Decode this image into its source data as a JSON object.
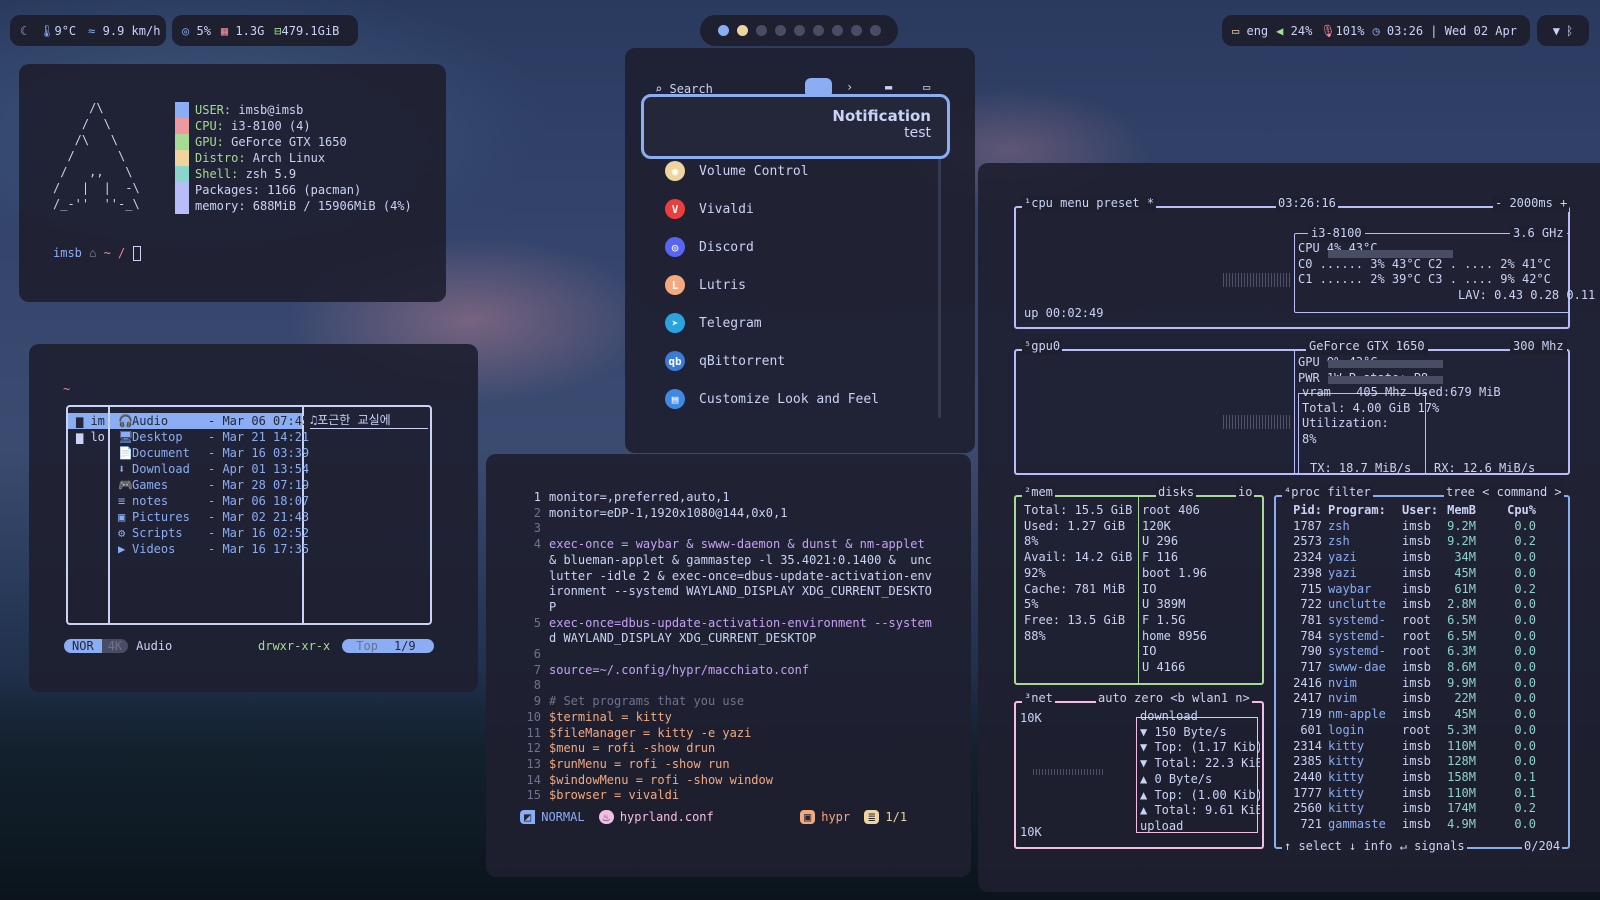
{
  "topbar": {
    "weather": {
      "temp": "9°C",
      "wind": "9.9 km/h"
    },
    "sys": {
      "cpu": "5%",
      "mem": "1.3G",
      "disk": "479.1GiB"
    },
    "right": {
      "lang": "eng",
      "volume": "24%",
      "mic": "101%",
      "clock": "03:26 | Wed 02 Apr"
    },
    "workspaces": 9,
    "active_workspace": 2
  },
  "fastfetch": {
    "logo": "     /\\\n    /  \\\n   /\\   \\\n  /      \\\n /   ,,   \\\n/   |  |  -\\\n/_-''  ''-_\\",
    "lines": [
      {
        "key": "USER:",
        "val": " imsb@imsb",
        "color": "#8aadf4"
      },
      {
        "key": "CPU:",
        "val": " i3-8100 (4)",
        "color": "#ee99a0"
      },
      {
        "key": "GPU:",
        "val": " GeForce GTX 1650",
        "color": "#a6da95"
      },
      {
        "key": "Distro:",
        "val": " Arch Linux",
        "color": "#eed49f"
      },
      {
        "key": "Shell:",
        "val": " zsh 5.9",
        "color": "#8bd5ca"
      },
      {
        "key": "",
        "val": "Packages: 1166 (pacman)",
        "color": "#b7bdf8"
      },
      {
        "key": "",
        "val": "memory: 688MiB / 15906MiB (4%)",
        "color": "#b7bdf8"
      }
    ],
    "prompt_user": "imsb",
    "prompt_path": "~ /"
  },
  "yazi": {
    "tilde": "~",
    "parent": [
      "im",
      "lo"
    ],
    "files": [
      {
        "name": "Audio",
        "date": "- Mar 06 07:45",
        "icon": "🎧"
      },
      {
        "name": "Desktop",
        "date": "- Mar 21 14:21",
        "icon": "🖥"
      },
      {
        "name": "Document",
        "date": "- Mar 16 03:39",
        "icon": "📄"
      },
      {
        "name": "Download",
        "date": "- Apr 01 13:54",
        "icon": "⬇"
      },
      {
        "name": "Games",
        "date": "- Mar 28 07:19",
        "icon": "🎮"
      },
      {
        "name": "notes",
        "date": "- Mar 06 18:07",
        "icon": "≡"
      },
      {
        "name": "Pictures",
        "date": "- Mar 02 21:43",
        "icon": "▣"
      },
      {
        "name": "Scripts",
        "date": "- Mar 16 02:52",
        "icon": "⚙"
      },
      {
        "name": "Videos",
        "date": "- Mar 16 17:35",
        "icon": "▶"
      }
    ],
    "preview": "♫포근한 교실에",
    "mode": "NOR",
    "size": "4K",
    "current": "Audio",
    "perms": "drwxr-xr-x",
    "pos_label": "Top",
    "count": "1/9"
  },
  "launcher": {
    "search_placeholder": "Search",
    "notification": {
      "title": "Notification",
      "body": "test"
    },
    "apps": [
      {
        "name": "Volume Control",
        "color": "#eed49f",
        "icon": "◉"
      },
      {
        "name": "Vivaldi",
        "color": "#ed3e3e",
        "icon": "V"
      },
      {
        "name": "Discord",
        "color": "#5865f2",
        "icon": "◎"
      },
      {
        "name": "Lutris",
        "color": "#f5a97f",
        "icon": "L"
      },
      {
        "name": "Telegram",
        "color": "#2aa3e0",
        "icon": "➤"
      },
      {
        "name": "qBittorrent",
        "color": "#3a7bd5",
        "icon": "qb"
      },
      {
        "name": "Customize Look and Feel",
        "color": "#3f8ae0",
        "icon": "▤"
      }
    ]
  },
  "editor": {
    "lines": [
      {
        "n": "1",
        "t": "monitor=,preferred,auto,1",
        "c": "#cad3f5"
      },
      {
        "n": "2",
        "t": "monitor=eDP-1,1920x1080@144,0x0,1",
        "c": "#cad3f5"
      },
      {
        "n": "3",
        "t": "",
        "c": "#cad3f5"
      },
      {
        "n": "4",
        "t": "exec-once = waybar & swww-daemon & dunst & nm-applet",
        "c": "#c6a0f6"
      },
      {
        "n": "",
        "t": "& blueman-applet & gammastep -l 35.4021:0.1400 &  unc",
        "c": "#cad3f5"
      },
      {
        "n": "",
        "t": "lutter -idle 2 & exec-once=dbus-update-activation-env",
        "c": "#cad3f5"
      },
      {
        "n": "",
        "t": "ironment --systemd WAYLAND_DISPLAY XDG_CURRENT_DESKTO",
        "c": "#cad3f5"
      },
      {
        "n": "",
        "t": "P",
        "c": "#cad3f5"
      },
      {
        "n": "5",
        "t": "exec-once=dbus-update-activation-environment --system",
        "c": "#c6a0f6"
      },
      {
        "n": "",
        "t": "d WAYLAND_DISPLAY XDG_CURRENT_DESKTOP",
        "c": "#cad3f5"
      },
      {
        "n": "6",
        "t": "",
        "c": "#cad3f5"
      },
      {
        "n": "7",
        "t": "source=~/.config/hypr/macchiato.conf",
        "c": "#c6a0f6"
      },
      {
        "n": "8",
        "t": "",
        "c": "#cad3f5"
      },
      {
        "n": "9",
        "t": "# Set programs that you use",
        "c": "#6e738d"
      },
      {
        "n": "10",
        "t": "$terminal = kitty",
        "c": "#f5a97f"
      },
      {
        "n": "11",
        "t": "$fileManager = kitty -e yazi",
        "c": "#f5a97f"
      },
      {
        "n": "12",
        "t": "$menu = rofi -show drun",
        "c": "#f5a97f"
      },
      {
        "n": "13",
        "t": "$runMenu = rofi -show run",
        "c": "#f5a97f"
      },
      {
        "n": "14",
        "t": "$windowMenu = rofi -show window",
        "c": "#f5a97f"
      },
      {
        "n": "15",
        "t": "$browser = vivaldi",
        "c": "#f5a97f"
      }
    ],
    "status": {
      "mode": "NORMAL",
      "file": "hyprland.conf",
      "ft": "hypr",
      "pos": "1/1"
    }
  },
  "btop": {
    "cpu": {
      "title": "¹cpu",
      "menu": "menu",
      "preset": "preset *",
      "time": "03:26:16",
      "interval": "- 2000ms +",
      "model": "i3-8100",
      "freq": "3.6 GHz",
      "uptime": "up 00:02:49",
      "rows": [
        "CPU                      4%   43°C",
        "C0 ......  3%  43°C C2 . ....  2%  41°C",
        "C1 ......  2%  39°C C3 . ....  9%  42°C"
      ],
      "lav": "LAV: 0.43 0.28 0.11"
    },
    "gpu": {
      "title": "⁵gpu0",
      "name": "GeForce GTX 1650",
      "clock": "300 Mhz",
      "rows": [
        "GPU                      9%   43°C",
        "PWR                      1W P-state:  P8"
      ],
      "vram": "vram",
      "vram_clock": "405 Mhz",
      "used": "Used:",
      "used_val": "679 MiB",
      "total": "Total:  4.00 GiB",
      "pct": "17%",
      "util": "Utilization:",
      "util_val": "8%",
      "tx": "TX:",
      "tx_val": "18.7 MiB/s",
      "rx": "RX:",
      "rx_val": "12.6 MiB/s"
    },
    "mem": {
      "title": "²mem",
      "disks": "disks",
      "io": "io",
      "left": [
        "Total: 15.5 GiB",
        "Used:  1.27 GiB",
        "              8%",
        "Avail: 14.2 GiB",
        "             92%",
        "Cache:  781 MiB",
        "              5%",
        "Free:  13.5 GiB",
        "             88%"
      ],
      "right": [
        "root          406",
        "120K",
        "U           296",
        "F           116",
        "boot         1.96",
        "IO",
        "U          389M",
        "F          1.5G",
        "home         8956",
        "IO",
        "U          4166"
      ]
    },
    "net": {
      "title": "³net",
      "auto": "auto",
      "zero": "zero",
      "iface": "<b wlan1 n>",
      "scale_top": "10K",
      "scale_bot": "10K",
      "lines": [
        "download",
        "▼ 150 Byte/s",
        "▼ Top: (1.17 Kib)",
        "▼ Total: 22.3 KiB",
        "▲ 0 Byte/s",
        "▲ Top: (1.00 Kib)",
        "▲ Total: 9.61 KiB",
        "upload"
      ]
    },
    "proc": {
      "title": "⁴proc",
      "filter": "filter",
      "tree": "tree",
      "command": "< command >",
      "header": {
        "pid": "Pid:",
        "prog": "Program:",
        "user": "User:",
        "mem": "MemB",
        "cpu": "Cpu%"
      },
      "rows": [
        [
          "1787",
          "zsh",
          "imsb",
          "9.2M",
          "0.0"
        ],
        [
          "2573",
          "zsh",
          "imsb",
          "9.2M",
          "0.2"
        ],
        [
          "2324",
          "yazi",
          "imsb",
          "34M",
          "0.0"
        ],
        [
          "2398",
          "yazi",
          "imsb",
          "45M",
          "0.0"
        ],
        [
          "715",
          "waybar",
          "imsb",
          "61M",
          "0.2"
        ],
        [
          "722",
          "unclutte",
          "imsb",
          "2.8M",
          "0.0"
        ],
        [
          "781",
          "systemd-",
          "root",
          "6.5M",
          "0.0"
        ],
        [
          "784",
          "systemd-",
          "root",
          "6.5M",
          "0.0"
        ],
        [
          "790",
          "systemd-",
          "root",
          "6.3M",
          "0.0"
        ],
        [
          "717",
          "swww-dae",
          "imsb",
          "8.6M",
          "0.0"
        ],
        [
          "2416",
          "nvim",
          "imsb",
          "9.9M",
          "0.0"
        ],
        [
          "2417",
          "nvim",
          "imsb",
          "22M",
          "0.0"
        ],
        [
          "719",
          "nm-apple",
          "imsb",
          "45M",
          "0.0"
        ],
        [
          "601",
          "login",
          "root",
          "5.3M",
          "0.0"
        ],
        [
          "2314",
          "kitty",
          "imsb",
          "110M",
          "0.0"
        ],
        [
          "2385",
          "kitty",
          "imsb",
          "128M",
          "0.0"
        ],
        [
          "2440",
          "kitty",
          "imsb",
          "158M",
          "0.1"
        ],
        [
          "1777",
          "kitty",
          "imsb",
          "110M",
          "0.1"
        ],
        [
          "2560",
          "kitty",
          "imsb",
          "174M",
          "0.2"
        ],
        [
          "721",
          "gammaste",
          "imsb",
          "4.9M",
          "0.0"
        ]
      ],
      "footer": {
        "select": "↑ select ↓",
        "info": "info ↵",
        "signals": "signals",
        "count": "0/204"
      }
    }
  }
}
